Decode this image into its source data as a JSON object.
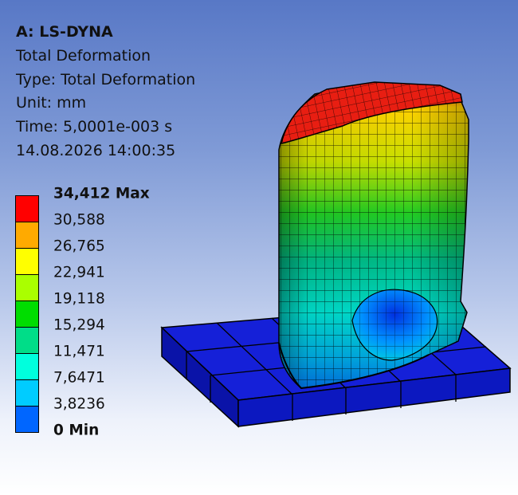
{
  "header": {
    "title": "A: LS-DYNA",
    "result_name": "Total Deformation",
    "type_line": "Type: Total Deformation",
    "unit_line": "Unit: mm",
    "time_line": "Time: 5,0001e-003 s",
    "timestamp": "14.08.2026 14:00:35"
  },
  "legend": {
    "labels": [
      "34,412 Max",
      "30,588",
      "26,765",
      "22,941",
      "19,118",
      "15,294",
      "11,471",
      "7,6471",
      "3,8236",
      "0 Min"
    ],
    "colors": [
      "#ff0000",
      "#ffaa00",
      "#ffff00",
      "#aaff00",
      "#00dd00",
      "#00dd88",
      "#00ffdd",
      "#00ccff",
      "#0066ff",
      "#0000ff"
    ]
  }
}
